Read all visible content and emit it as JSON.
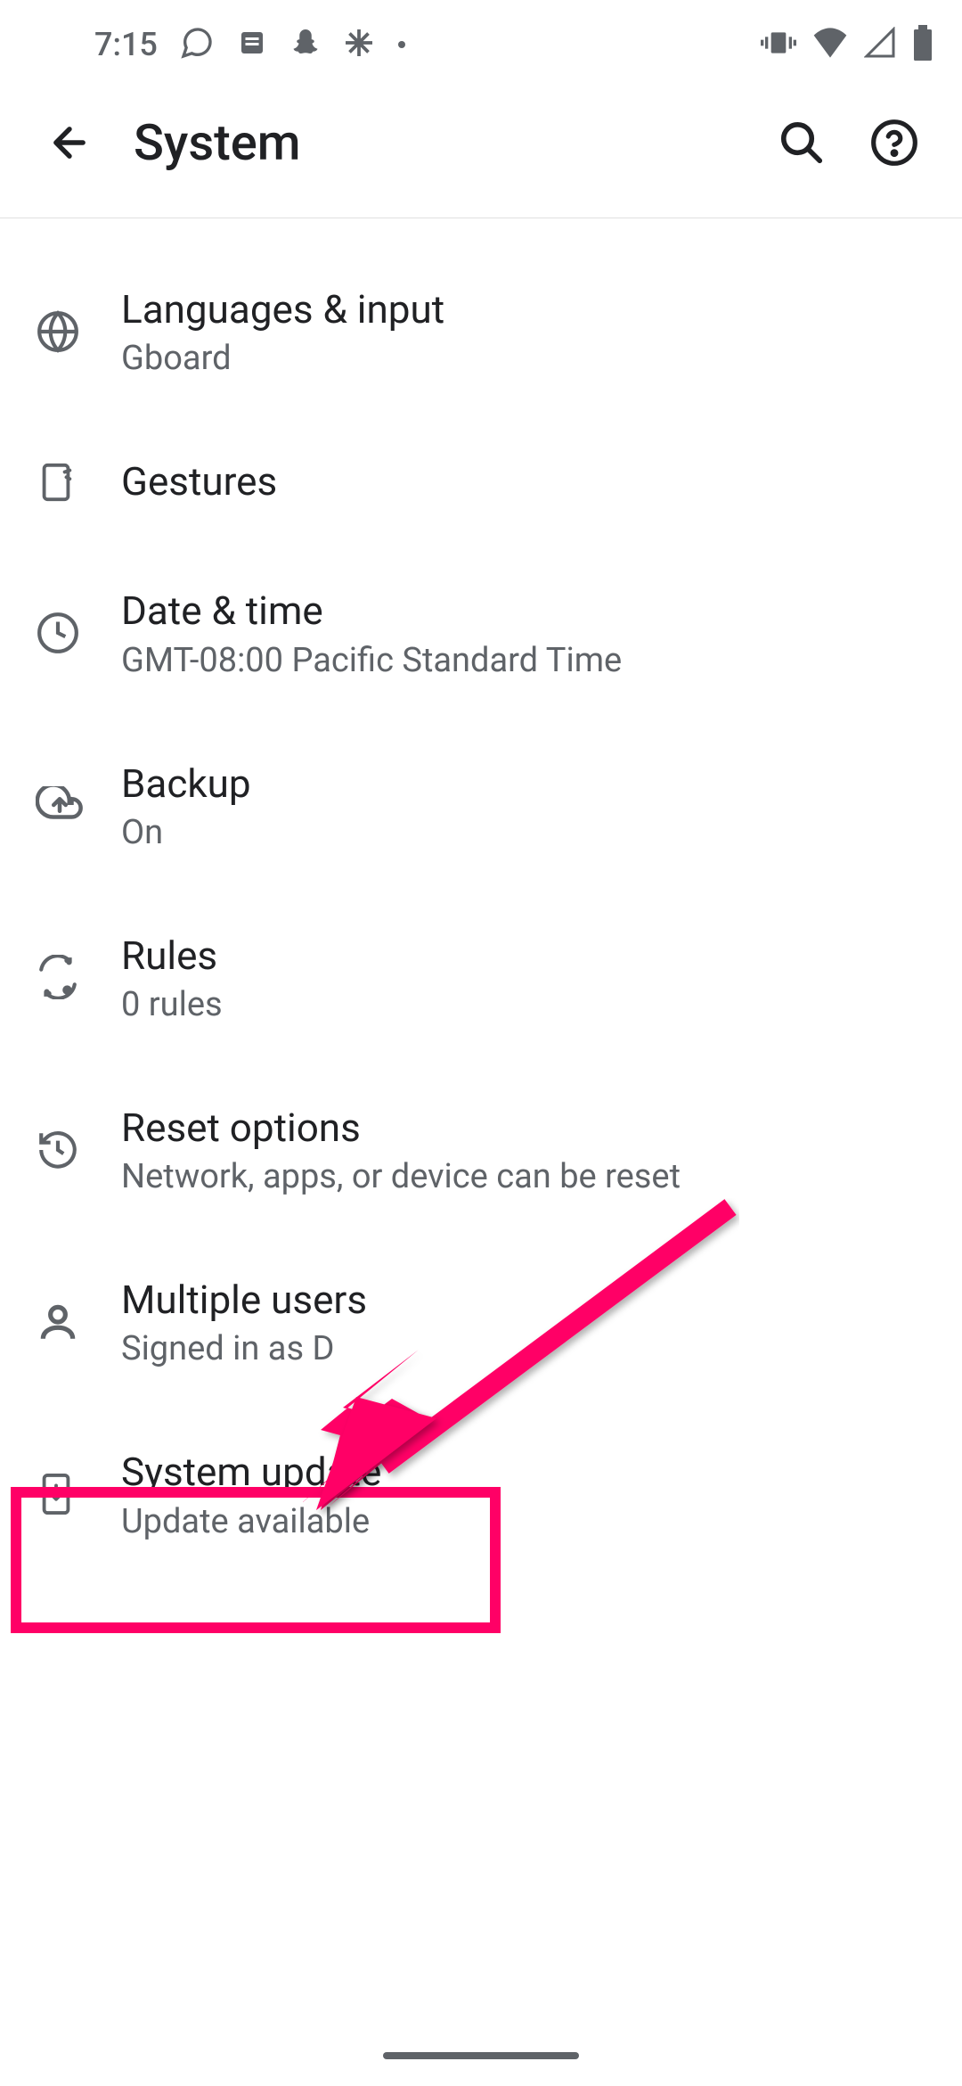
{
  "status_bar": {
    "time": "7:15"
  },
  "header": {
    "title": "System"
  },
  "settings": [
    {
      "title": "Languages & input",
      "subtitle": "Gboard"
    },
    {
      "title": "Gestures",
      "subtitle": null
    },
    {
      "title": "Date & time",
      "subtitle": "GMT-08:00 Pacific Standard Time"
    },
    {
      "title": "Backup",
      "subtitle": "On"
    },
    {
      "title": "Rules",
      "subtitle": "0 rules"
    },
    {
      "title": "Reset options",
      "subtitle": "Network, apps, or device can be reset"
    },
    {
      "title": "Multiple users",
      "subtitle": "Signed in as D"
    },
    {
      "title": "System update",
      "subtitle": "Update available"
    }
  ],
  "annotation": {
    "highlight_color": "#ff0066"
  }
}
